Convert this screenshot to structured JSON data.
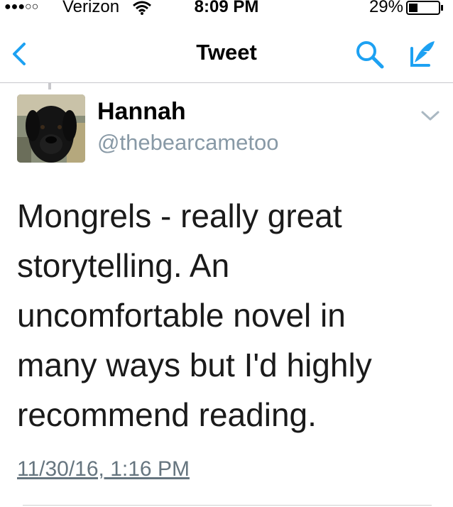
{
  "status_bar": {
    "signal": "●●●○○",
    "carrier": "Verizon",
    "wifi_icon": "wifi-icon",
    "time": "8:09 PM",
    "battery_percent": "29%",
    "battery_level": 0.29,
    "battery_icon": "battery-icon"
  },
  "nav": {
    "back_icon": "chevron-left-icon",
    "title": "Tweet",
    "search_icon": "search-icon",
    "compose_icon": "compose-icon",
    "accent_color": "#1da1f2"
  },
  "tweet": {
    "display_name": "Hannah",
    "handle": "@thebearcametoo",
    "avatar_icon": "avatar",
    "more_icon": "chevron-down-icon",
    "text_lines": [
      "Mongrels - really great",
      "storytelling. An",
      "uncomfortable novel in",
      "many ways but I'd highly",
      "recommend reading."
    ],
    "timestamp": "11/30/16, 1:16 PM"
  }
}
